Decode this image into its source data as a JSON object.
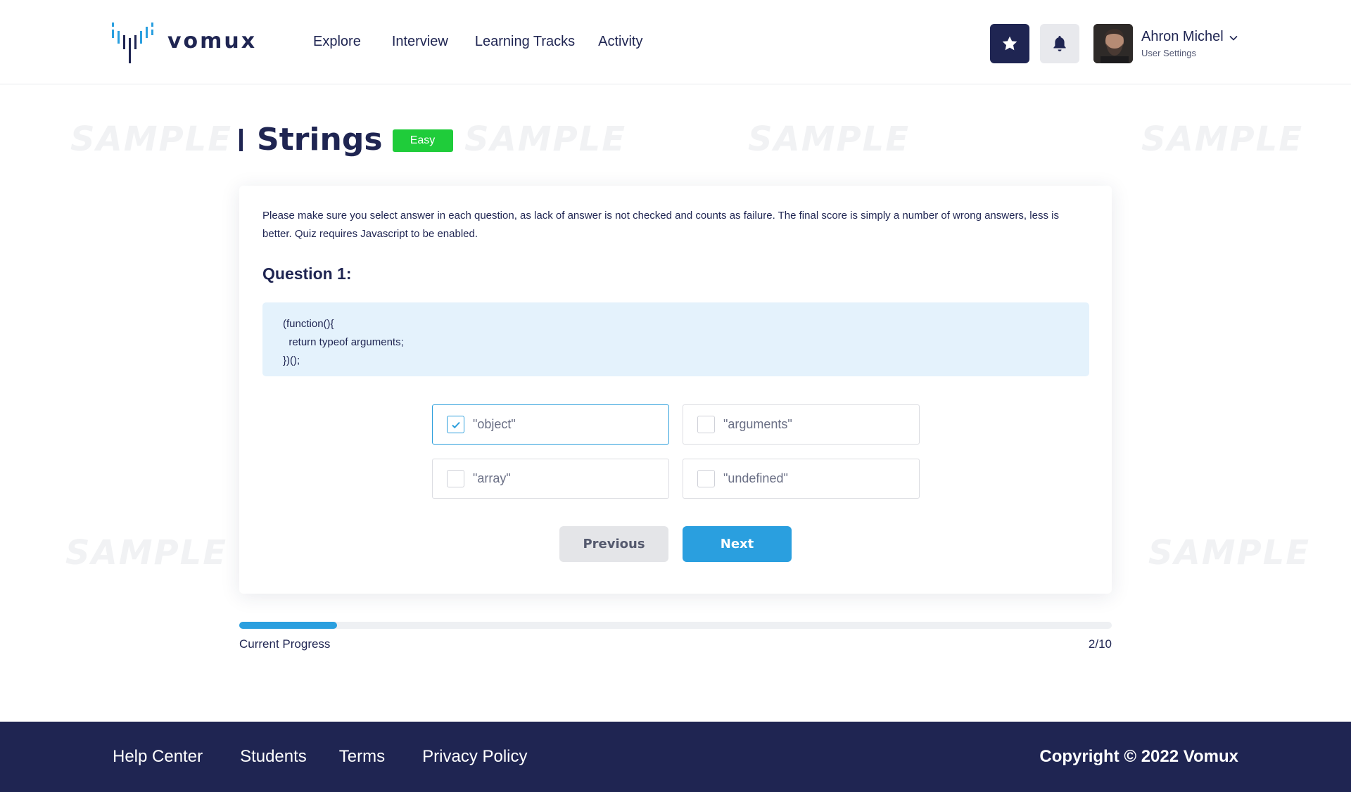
{
  "brand": {
    "name": "vomux"
  },
  "nav": {
    "items": [
      {
        "label": "Explore"
      },
      {
        "label": "Interview"
      },
      {
        "label": "Learning Tracks"
      },
      {
        "label": "Activity"
      }
    ]
  },
  "header": {
    "star_icon": "star-icon",
    "bell_icon": "bell-icon",
    "user": {
      "name": "Ahron Michel",
      "subtitle": "User Settings"
    }
  },
  "page": {
    "title": "Strings",
    "difficulty": "Easy",
    "difficulty_color": "#1fcc3a"
  },
  "quiz": {
    "instructions": "Please make sure you select answer in each question, as lack of answer is not checked and counts as failure. The final score is simply a number of wrong answers, less is better. Quiz requires Javascript to be enabled.",
    "question_title": "Question 1:",
    "code_lines": [
      "(function(){",
      "  return typeof arguments;",
      "})();"
    ],
    "options": [
      {
        "label": "\"object\"",
        "checked": true
      },
      {
        "label": "\"arguments\"",
        "checked": false
      },
      {
        "label": "\"array\"",
        "checked": false
      },
      {
        "label": "\"undefined\"",
        "checked": false
      }
    ],
    "previous_label": "Previous",
    "next_label": "Next"
  },
  "progress": {
    "label": "Current Progress",
    "count": "2/10",
    "fraction": 0.112
  },
  "footer": {
    "links": [
      {
        "label": "Help Center"
      },
      {
        "label": "Students"
      },
      {
        "label": "Terms"
      },
      {
        "label": "Privacy Policy"
      }
    ],
    "copyright": "Copyright © 2022 Vomux"
  },
  "watermark": "SAMPLE",
  "colors": {
    "primary": "#1f2552",
    "accent": "#2a9fdf",
    "code_bg": "#e4f2fc"
  }
}
